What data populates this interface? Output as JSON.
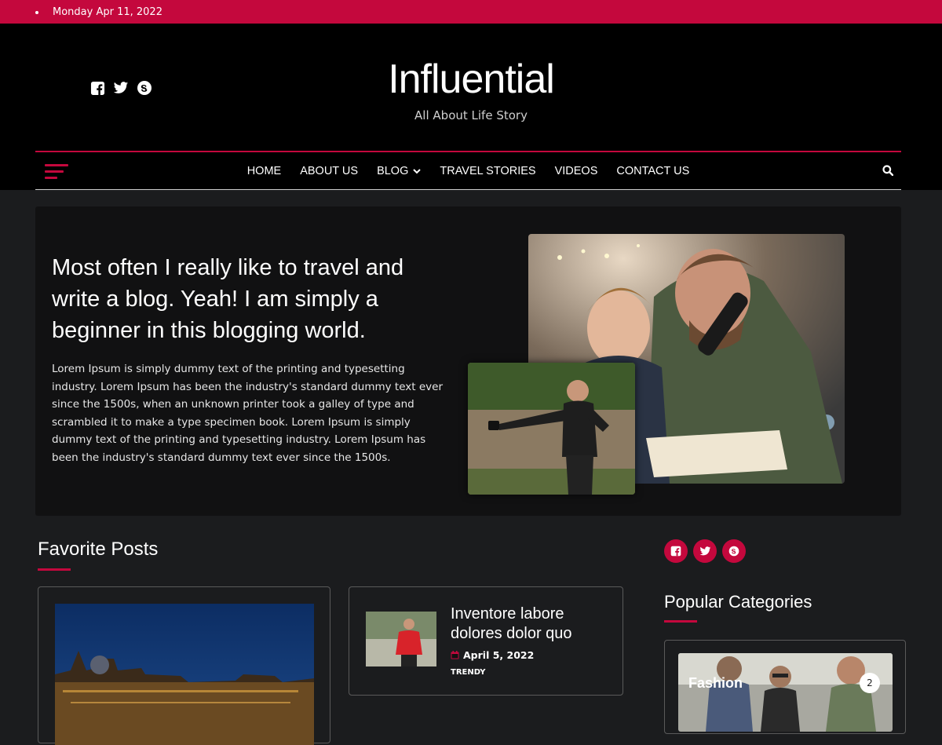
{
  "topbar": {
    "date": "Monday Apr 11, 2022"
  },
  "site": {
    "title": "Influential",
    "tagline": "All About Life Story"
  },
  "social": [
    "facebook-icon",
    "twitter-icon",
    "skype-icon"
  ],
  "nav": {
    "items": [
      {
        "label": "HOME"
      },
      {
        "label": "ABOUT US"
      },
      {
        "label": "BLOG",
        "has_dropdown": true
      },
      {
        "label": "TRAVEL STORIES"
      },
      {
        "label": "VIDEOS"
      },
      {
        "label": "CONTACT US"
      }
    ]
  },
  "hero": {
    "heading": "Most often I really like to travel and write a blog. Yeah! I am simply a beginner in this blogging world.",
    "body": "Lorem Ipsum is simply dummy text of the printing and typesetting industry. Lorem Ipsum has been the industry's standard dummy text ever since the 1500s, when an unknown printer took a galley of type and scrambled it to make a type specimen book. Lorem Ipsum is simply dummy text of the printing and typesetting industry. Lorem Ipsum has been the industry's standard dummy text ever since the 1500s."
  },
  "favorites": {
    "title": "Favorite Posts",
    "post": {
      "title": "Inventore labore dolores dolor quo",
      "date": "April 5, 2022",
      "category": "TRENDY"
    }
  },
  "sidebar": {
    "categories_title": "Popular Categories",
    "category": {
      "name": "Fashion",
      "count": "2"
    }
  },
  "colors": {
    "accent": "#c4083d",
    "background": "#1b1c1e",
    "header": "#000000"
  }
}
